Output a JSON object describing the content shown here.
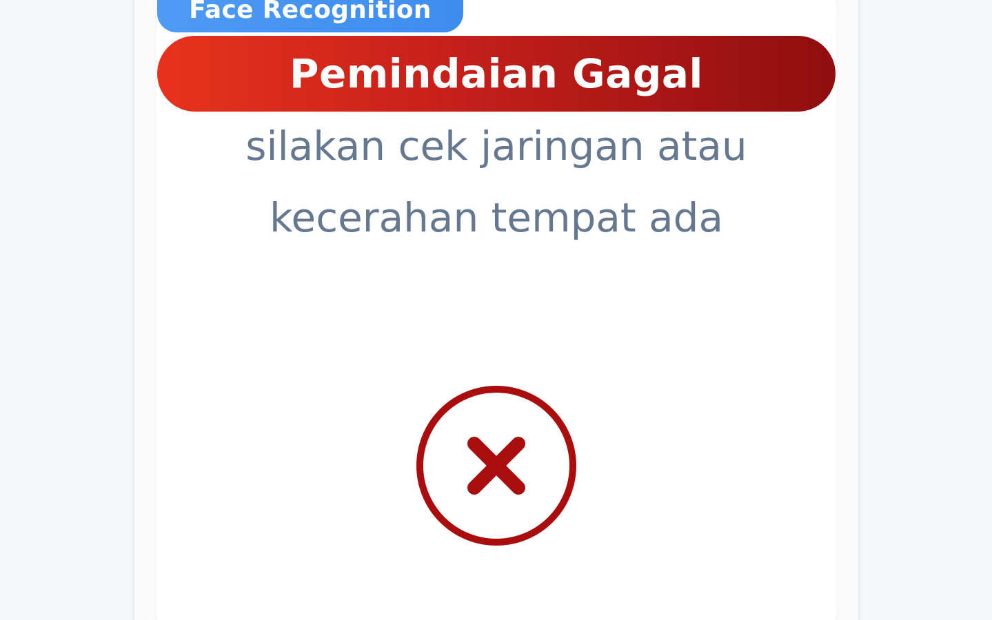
{
  "badge": {
    "label": "Face Recognition",
    "color": "#4d9bf3"
  },
  "status": {
    "title": "Pemindaian Gagal",
    "color_start": "#e7331d",
    "color_end": "#8f0e10"
  },
  "message": {
    "line1": "silakan cek jaringan atau",
    "line2": "kecerahan tempat ada"
  },
  "result_icon": {
    "name": "close-circle-icon",
    "color": "#a90d0d"
  }
}
